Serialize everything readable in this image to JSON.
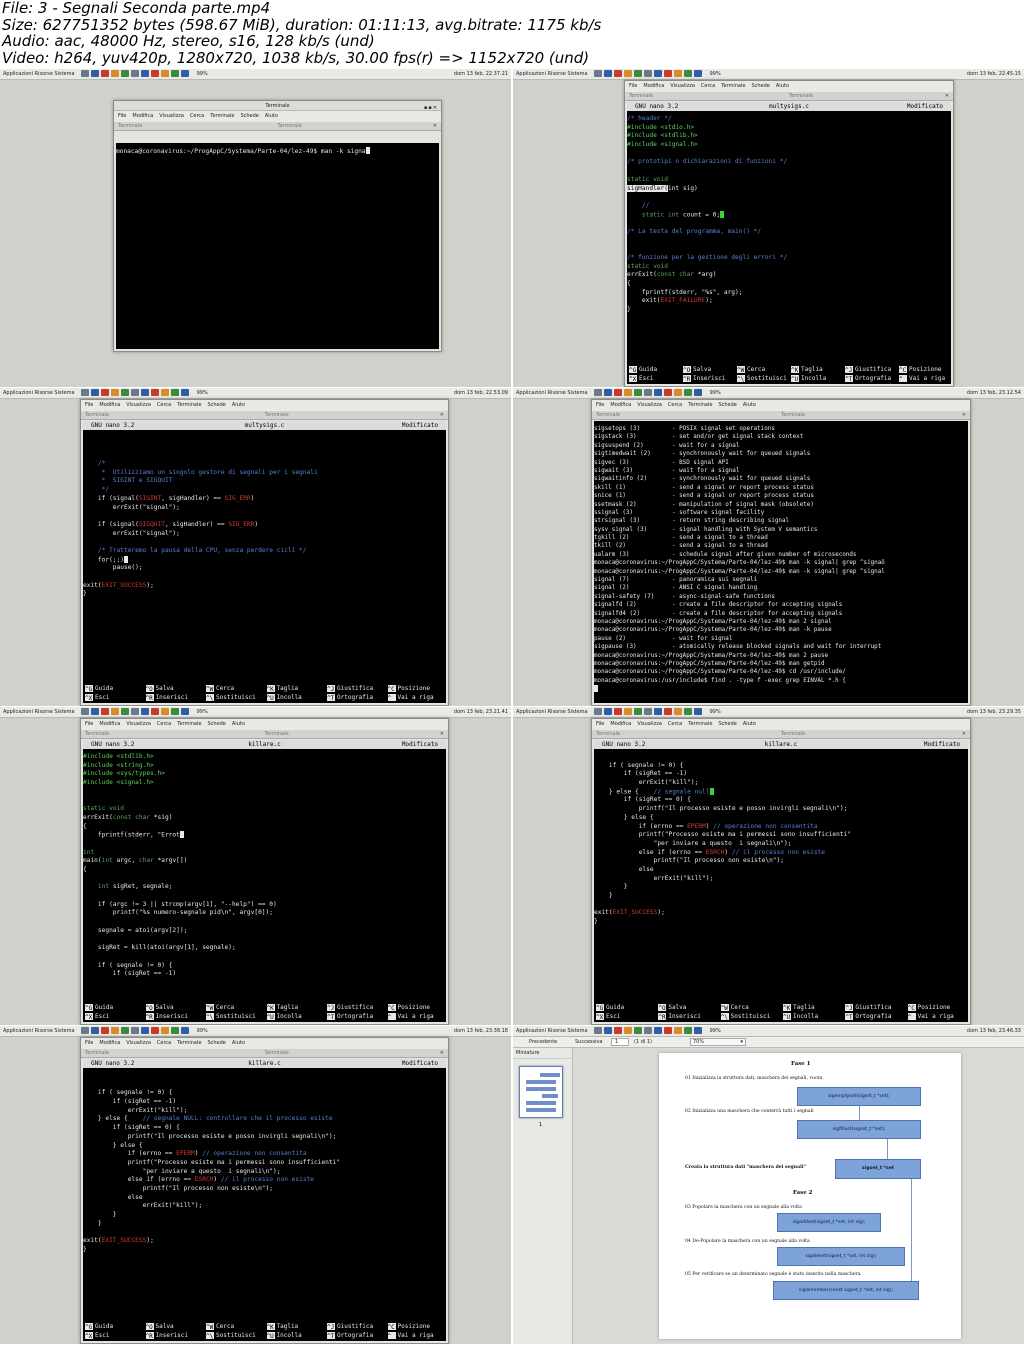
{
  "header": {
    "line1": "File: 3 - Segnali Seconda parte.mp4",
    "line2": "Size: 627751352 bytes (598.67 MiB), duration: 01:11:13, avg.bitrate: 1175 kb/s",
    "line3": "Audio: aac, 48000 Hz, stereo, s16, 128 kb/s (und)",
    "line4": "Video: h264, yuv420p, 1280x720, 1038 kb/s, 30.00 fps(r) => 1152x720 (und)"
  },
  "topbar": {
    "menus": "Applicazioni  Risorse  Sistema",
    "battery": "99%",
    "clocks": [
      "dom 13 feb, 22.37.21",
      "dom 13 feb, 22.45.15",
      "dom 13 feb, 22.53.09",
      "dom 13 feb, 23.12.54",
      "dom 13 feb, 23.21.41",
      "dom 13 feb, 23.29.35",
      "dom 13 feb, 23.38.18",
      "dom 13 feb, 23.46.33"
    ]
  },
  "terminal": {
    "title": "Terminale",
    "menu": [
      "File",
      "Modifica",
      "Visualizza",
      "Cerca",
      "Terminale",
      "Schede",
      "Aiuto"
    ],
    "tab_label": "Terminale"
  },
  "nano": {
    "version": "GNU nano 3.2",
    "modified": "Modificato",
    "help": [
      {
        "k1": "G",
        "l1": "Guida",
        "k2": "X",
        "l2": "Esci"
      },
      {
        "k1": "O",
        "l1": "Salva",
        "k2": "R",
        "l2": "Inserisci"
      },
      {
        "k1": "W",
        "l1": "Cerca",
        "k2": "\\",
        "l2": "Sostituisci"
      },
      {
        "k1": "K",
        "l1": "Taglia",
        "k2": "U",
        "l2": "Incolla"
      },
      {
        "k1": "J",
        "l1": "Giustifica",
        "k2": "T",
        "l2": "Ortografia"
      },
      {
        "k1": "C",
        "l1": "Posizione",
        "k2": "_",
        "l2": "Vai a riga"
      }
    ]
  },
  "frames": {
    "f1": {
      "prompt": "monaca@coronavirus:~/ProgAppC/Systema/Parte-04/lez-49$ man -k signa"
    },
    "f2": {
      "filename": "multysigs.c",
      "lines": [
        "/* header */",
        "#include <stdio.h>",
        "#include <stdlib.h>",
        "#include <signal.h>",
        "",
        "/* prototipi o dichiarazioni di funzioni */",
        "",
        "static void",
        "sigHandler(int sig)",
        "",
        "    //",
        "    static int count = 0;",
        "",
        "/* La testa del programma, main() */",
        "",
        "",
        "/* funzione per la gestione degli errori */",
        "static void",
        "errExit(const char *arg)",
        "{",
        "    fprintf(stderr, \"%s\", arg);",
        "    exit(EXIT_FAILURE);",
        "}"
      ]
    },
    "f3": {
      "filename": "multysigs.c",
      "lines": [
        "",
        "",
        "",
        "    /*",
        "     *  Utilizziamo un singolo gestore di segnali per i segnali",
        "     *  SIGINT e SIGQUIT",
        "     */",
        "    if (signal(SIGINT, sigHandler) == SIG_ERR)",
        "        errExit(\"signal\");",
        "",
        "    if (signal(SIGQUIT, sigHandler) == SIG_ERR)",
        "        errExit(\"signal\");",
        "",
        "    /* Tratteremo la pausa della CPU, senza perdere cicli */",
        "    for(;;)",
        "        pause();",
        "",
        "exit(EXIT_SUCCESS);",
        "}"
      ]
    },
    "f4": {
      "lines": [
        "sigsetops (3)         - POSIX signal set operations",
        "sigstack (3)          - set and/or get signal stack context",
        "sigsuspend (2)        - wait for a signal",
        "sigtimedwait (2)      - synchronously wait for queued signals",
        "sigvec (3)            - BSD signal API",
        "sigwait (3)           - wait for a signal",
        "sigwaitinfo (2)       - synchronously wait for queued signals",
        "skill (1)             - send a signal or report process status",
        "snice (1)             - send a signal or report process status",
        "ssetmask (2)          - manipulation of signal mask (obsolete)",
        "ssignal (3)           - software signal facility",
        "strsignal (3)         - return string describing signal",
        "sysv_signal (3)       - signal handling with System V semantics",
        "tgkill (2)            - send a signal to a thread",
        "tkill (2)             - send a signal to a thread",
        "ualarm (3)            - schedule signal after given number of microseconds",
        "monaca@coronavirus:~/ProgAppC/Systema/Parte-04/lez-49$ man -k signal| grep ^signaö",
        "monaca@coronavirus:~/ProgAppC/Systema/Parte-04/lez-49$ man -k signal| grep ^signal",
        "signal (7)            - panoramica sui segnali",
        "signal (2)            - ANSI C signal handling",
        "signal-safety (7)     - async-signal-safe functions",
        "signalfd (2)          - create a file descriptor for accepting signals",
        "signalfd4 (2)         - create a file descriptor for accepting signals",
        "monaca@coronavirus:~/ProgAppC/Systema/Parte-04/lez-49$ man 2 signal",
        "monaca@coronavirus:~/ProgAppC/Systema/Parte-04/lez-49$ man -k pause",
        "pause (2)             - wait for signal",
        "sigpause (3)          - atomically release blocked signals and wait for interrupt",
        "monaca@coronavirus:~/ProgAppC/Systema/Parte-04/lez-49$ man 2 pause",
        "monaca@coronavirus:~/ProgAppC/Systema/Parte-04/lez-49$ man getpid",
        "monaca@coronavirus:~/ProgAppC/Systema/Parte-04/lez-49$ cd /usr/include/",
        "monaca@coronavirus:/usr/include$ find . -type f -exec grep EINVAL *.h {"
      ]
    },
    "f5": {
      "filename": "killare.c",
      "lines": [
        "#include <stdlib.h>",
        "#include <string.h>",
        "#include <sys/types.h>",
        "#include <signal.h>",
        "",
        "",
        "static void",
        "errExit(const char *sig)",
        "{",
        "    fprintf(stderr, \"Errot",
        "",
        "int",
        "main(int argc, char *argv[])",
        "{",
        "",
        "    int sigRet, segnale;",
        "",
        "    if (argc != 3 || strcmp(argv[1], \"--help\") == 0)",
        "        printf(\"%s numero-segnale pid\\n\", argv[0]);",
        "",
        "    segnale = atoi(argv[2]);",
        "",
        "    sigRet = kill(atoi(argv[1], segnale);",
        "",
        "    if ( segnale != 0) {",
        "        if (sigRet == -1)"
      ]
    },
    "f6": {
      "filename": "killare.c",
      "lines": [
        "",
        "    if ( segnale != 0) {",
        "        if (sigRet == -1)",
        "            errExit(\"kill\");",
        "    } else {    // segnale null",
        "        if (sigRet == 0) {",
        "            printf(\"Il processo esiste e posso invirgli segnali\\n\");",
        "        } else {",
        "            if (errno == EPERM) // operazione non consentita",
        "            printf(\"Processo esiste ma i permessi sono insufficienti\"",
        "                \"per inviare a questo  i segnali\\n\");",
        "            else if (errno == ESRCH) // il processo non esiste",
        "                printf(\"Il processo non esiste\\n\");",
        "            else",
        "                errExit(\"kill\");",
        "        }",
        "    }",
        "",
        "exit(EXIT_SUCCESS);",
        "}"
      ]
    },
    "f7": {
      "filename": "killare.c",
      "lines": [
        "",
        "",
        "    if ( segnale != 0) {",
        "        if (sigRet == -1)",
        "            errExit(\"kill\");",
        "    } else {    // segnale NULL: controllare che il processo esiste",
        "        if (sigRet == 0) {",
        "            printf(\"Il processo esiste e posso invirgli segnali\\n\");",
        "        } else {",
        "            if (errno == EPERM) // operazione non consentita",
        "            printf(\"Processo esiste ma i permessi sono insufficienti\"",
        "                \"per inviare a questo  i segnali\\n\");",
        "            else if (errno == ESRCH) // il processo non esiste",
        "                printf(\"Il processo non esiste\\n\");",
        "            else",
        "                errExit(\"kill\");",
        "        }",
        "    }",
        "",
        "exit(EXIT_SUCCESS);",
        "}"
      ]
    },
    "f8": {
      "toolbar": {
        "prev": "Precedente",
        "next": "Successiva",
        "page": "1",
        "of": "(1 di 1)",
        "zoom": "70%"
      },
      "side_label": "Miniature",
      "thumb_page": "1",
      "phase1": "Fase 1",
      "phase2": "Fase 2",
      "s01": "01 Inizializza la struttura dati, maschera dei segnali, vuota",
      "s02": "02 Inizializza una maschera che conterrà tutti i segnali",
      "sc": "Creata la struttura dati \"maschera dei segnali\"",
      "s03": "03 Popolare la maschera con un segnale alla volta",
      "s04": "04 De-Popolare la maschera con un segnale alla volta",
      "s05": "05 Per verificare se un determinato segnale è stato inserito nella maschera",
      "b1": "sigemptyset(sigset_t *set);",
      "b2": "sigfillset(sigset_t *set);",
      "b3": "sigset_t *set",
      "b4": "sigaddset(sigset_t *set, int sig);",
      "b5": "sigdelset(sigset_t *set, int sig);",
      "b6": "sigismember(const sigset_t *set, int sig);"
    }
  }
}
